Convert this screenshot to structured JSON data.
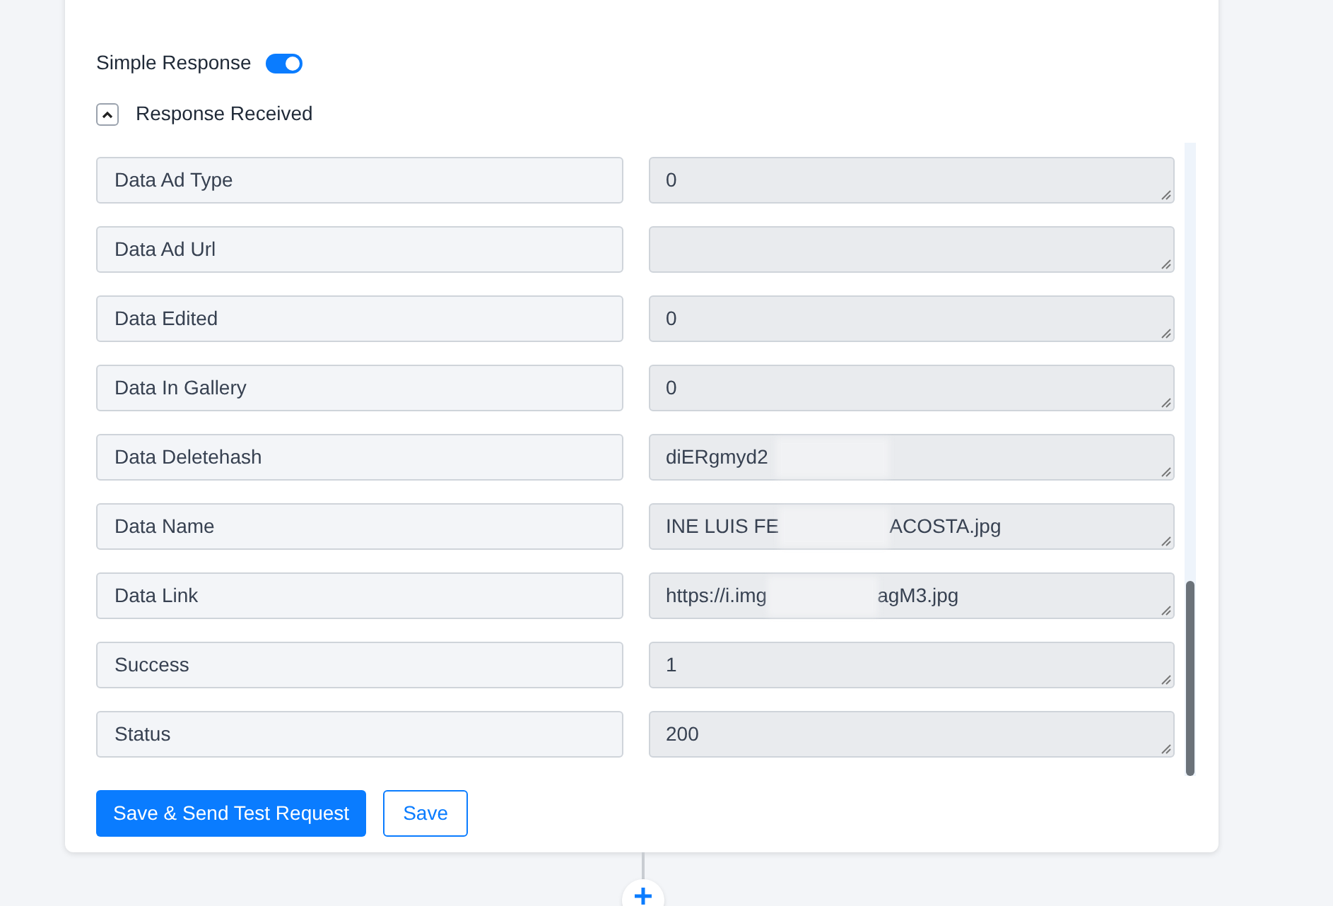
{
  "simple_response": {
    "label": "Simple Response",
    "on": true
  },
  "section": {
    "label": "Response Received",
    "expanded": true
  },
  "fields": [
    {
      "label": "Data Ad Type",
      "value": "0"
    },
    {
      "label": "Data Ad Url"
    },
    {
      "label": "Data Edited",
      "value": "0"
    },
    {
      "label": "Data In Gallery",
      "value": "0"
    },
    {
      "label": "Data Deletehash",
      "value": "diERgmyd2"
    },
    {
      "label": "Data Name",
      "value": "INE LUIS FE",
      "value_end": "ACOSTA.jpg"
    },
    {
      "label": "Data Link",
      "value": "https://i.img",
      "value_end": "agM3.jpg"
    },
    {
      "label": "Success",
      "value": "1"
    },
    {
      "label": "Status",
      "value": "200"
    }
  ],
  "buttons": {
    "primary": "Save & Send Test Request",
    "secondary": "Save"
  }
}
